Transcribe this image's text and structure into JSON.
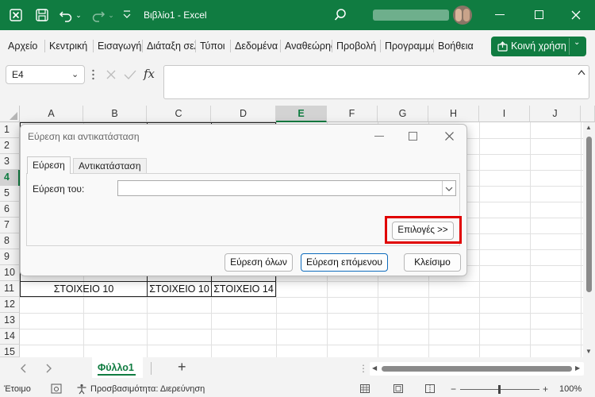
{
  "titlebar": {
    "title": "Βιβλίο1 - Excel"
  },
  "ribbon": {
    "tabs": [
      "Αρχείο",
      "Κεντρική",
      "Εισαγωγή",
      "Διάταξη σελίδας",
      "Τύποι",
      "Δεδομένα",
      "Αναθεώρηση",
      "Προβολή",
      "Προγραμματιστής",
      "Βοήθεια"
    ],
    "share_label": "Κοινή χρήση"
  },
  "formula_bar": {
    "name_box": "E4",
    "fx_label": "fx",
    "value": ""
  },
  "grid": {
    "columns": [
      "A",
      "B",
      "C",
      "D",
      "E",
      "F",
      "G",
      "H",
      "I",
      "J"
    ],
    "rows": [
      "1",
      "2",
      "3",
      "4",
      "5",
      "6",
      "7",
      "8",
      "9",
      "10",
      "11",
      "12",
      "13",
      "14",
      "15"
    ],
    "cells": {
      "row11_ab": "ΣΤΟΙΧΕΙΟ 10",
      "row11_c": "ΣΤΟΙΧΕΙΟ 10",
      "row11_d": "ΣΤΟΙΧΕΙΟ 14"
    }
  },
  "sheet_tabs": {
    "active": "Φύλλο1",
    "add_label": "+"
  },
  "status": {
    "ready": "Έτοιμο",
    "accessibility": "Προσβασιμότητα: Διερεύνηση",
    "zoom": "100%"
  },
  "dialog": {
    "title": "Εύρεση και αντικατάσταση",
    "tabs": [
      "Εύρεση",
      "Αντικατάσταση"
    ],
    "find_label": "Εύρεση του:",
    "find_value": "",
    "options_button": "Επιλογές >>",
    "find_all_button": "Εύρεση όλων",
    "find_next_button": "Εύρεση επόμενου",
    "close_button": "Κλείσιμο"
  },
  "colors": {
    "excel_green": "#107c41",
    "highlight_red": "#e00000"
  }
}
